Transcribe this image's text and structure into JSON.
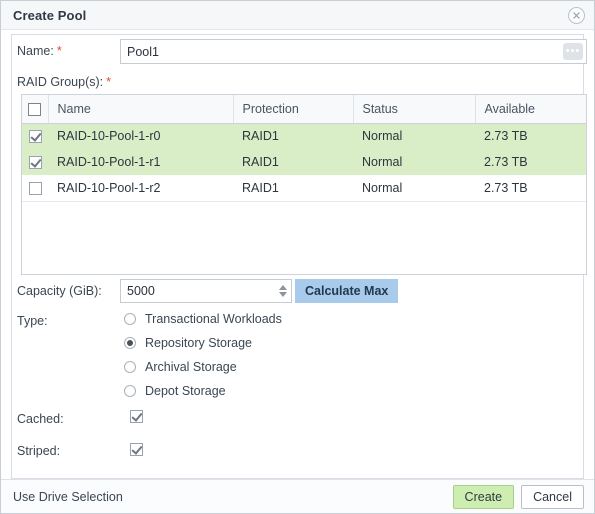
{
  "dialog": {
    "title": "Create Pool",
    "close_icon": "close-circle-icon"
  },
  "form": {
    "name": {
      "label": "Name:",
      "required_marker": "*",
      "value": "Pool1",
      "placeholder": "",
      "browse_icon": "ellipsis-icon"
    },
    "raid_groups": {
      "label": "RAID Group(s):",
      "required_marker": "*"
    },
    "capacity": {
      "label": "Capacity (GiB):",
      "value": "5000",
      "placeholder": "",
      "spinner_up_icon": "caret-up-icon",
      "spinner_down_icon": "caret-down-icon",
      "calculate_button": "Calculate Max"
    },
    "type": {
      "label": "Type:",
      "options": [
        {
          "label": "Transactional Workloads",
          "selected": false
        },
        {
          "label": "Repository Storage",
          "selected": true
        },
        {
          "label": "Archival Storage",
          "selected": false
        },
        {
          "label": "Depot Storage",
          "selected": false
        }
      ]
    },
    "cached": {
      "label": "Cached:",
      "checked": true
    },
    "striped": {
      "label": "Striped:",
      "checked": true
    }
  },
  "table": {
    "header_checkbox_checked": false,
    "columns": [
      "Name",
      "Protection",
      "Status",
      "Available"
    ],
    "rows": [
      {
        "checked": true,
        "name": "RAID-10-Pool-1-r0",
        "protection": "RAID1",
        "status": "Normal",
        "available": "2.73 TB"
      },
      {
        "checked": true,
        "name": "RAID-10-Pool-1-r1",
        "protection": "RAID1",
        "status": "Normal",
        "available": "2.73 TB"
      },
      {
        "checked": false,
        "name": "RAID-10-Pool-1-r2",
        "protection": "RAID1",
        "status": "Normal",
        "available": "2.73 TB"
      }
    ]
  },
  "footer": {
    "drive_selection_link": "Use Drive Selection",
    "create_button": "Create",
    "cancel_button": "Cancel"
  },
  "colors": {
    "selected_row": "#d9edc6",
    "primary_button": "#cdeeb0",
    "calc_button": "#a8cbec",
    "required_marker": "#e04b34"
  }
}
